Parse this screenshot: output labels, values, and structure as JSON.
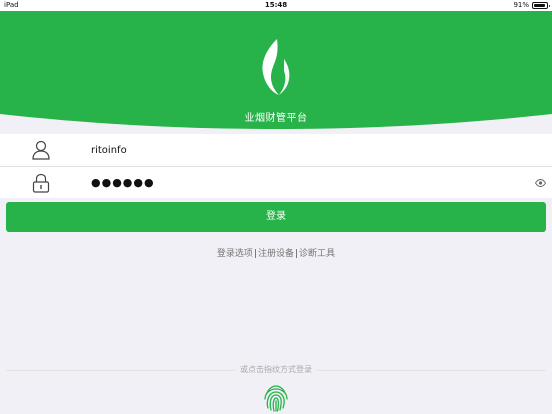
{
  "status_bar": {
    "device": "iPad",
    "time": "15:48",
    "battery_text": "91%",
    "battery_level": 0.91
  },
  "header": {
    "app_title": "业烟财管平台",
    "logo_icon": "leaf-flame-logo",
    "accent_color": "#27b34a"
  },
  "form": {
    "username_icon": "user-icon",
    "username_value": "ritoinfo",
    "password_icon": "lock-icon",
    "password_value": "●●●●●●",
    "reveal_icon": "eye-icon"
  },
  "login_button": {
    "label": "登录"
  },
  "links": {
    "login_options": "登录选项",
    "separator_1": "|",
    "register_device": "注册设备",
    "separator_2": "|",
    "diagnostic_tools": "诊断工具"
  },
  "fingerprint": {
    "hint": "或点击指纹方式登录",
    "icon": "fingerprint-icon"
  }
}
